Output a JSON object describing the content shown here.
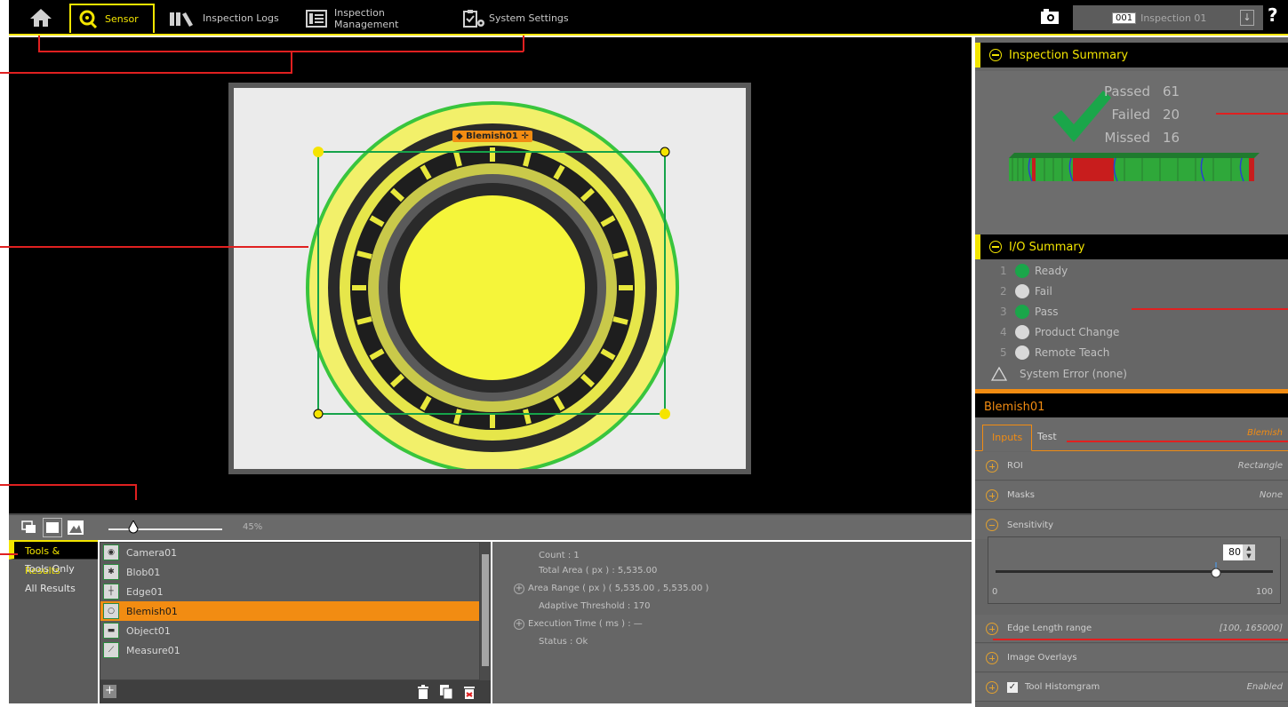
{
  "nav": {
    "tabs": [
      {
        "label": "Sensor",
        "icon": "sensor-icon"
      },
      {
        "label": "Inspection Logs",
        "icon": "books-icon"
      },
      {
        "label": "Inspection Management",
        "icon": "list-icon"
      },
      {
        "label": "System Settings",
        "icon": "clipboard-gear-icon"
      }
    ],
    "inspection_number": "001",
    "inspection_name": "Inspection 01",
    "help": "?"
  },
  "viewer": {
    "tool_label": "Blemish01",
    "zoom": "45%"
  },
  "results_nav": {
    "items": [
      "Tools & Results",
      "Tools Only",
      "All Results"
    ],
    "selected": "Tools & Results"
  },
  "tools": {
    "items": [
      "Camera01",
      "Blob01",
      "Edge01",
      "Blemish01",
      "Object01",
      "Measure01"
    ],
    "selected": "Blemish01"
  },
  "details": {
    "count": "Count :  1",
    "total_area": "Total Area ( px ) :  5,535.00",
    "area_range": "Area Range ( px ) ( 5,535.00 , 5,535.00 )",
    "adaptive_threshold": "Adaptive Threshold :  170",
    "execution_time": "Execution Time ( ms ) : —",
    "status": "Status : Ok"
  },
  "inspection_summary": {
    "title": "Inspection Summary",
    "passed_label": "Passed",
    "passed": "61",
    "failed_label": "Failed",
    "failed": "20",
    "missed_label": "Missed",
    "missed": "16"
  },
  "io_summary": {
    "title": "I/O Summary",
    "items": [
      {
        "num": "1",
        "label": "Ready",
        "state": "on"
      },
      {
        "num": "2",
        "label": "Fail",
        "state": "off"
      },
      {
        "num": "3",
        "label": "Pass",
        "state": "on"
      },
      {
        "num": "4",
        "label": "Product Change",
        "state": "off"
      },
      {
        "num": "5",
        "label": "Remote Teach",
        "state": "off"
      }
    ],
    "system_error": "System Error (none)"
  },
  "tool_panel": {
    "title": "Blemish01",
    "tab_inputs": "Inputs",
    "tab_test": "Test",
    "tool_type": "Blemish",
    "roi_label": "ROI",
    "roi_value": "Rectangle",
    "masks_label": "Masks",
    "masks_value": "None",
    "sensitivity_label": "Sensitivity",
    "sensitivity_value": "80",
    "sensitivity_min": "0",
    "sensitivity_max": "100",
    "edge_label": "Edge Length range",
    "edge_value": "[100, 165000]",
    "overlays_label": "Image Overlays",
    "histogram_label": "Tool Histomgram",
    "histogram_value": "Enabled"
  },
  "colors": {
    "accent_yellow": "#f3e500",
    "accent_orange": "#f28c12",
    "pass_green": "#1aa64a",
    "annotation_red": "#e02020"
  }
}
